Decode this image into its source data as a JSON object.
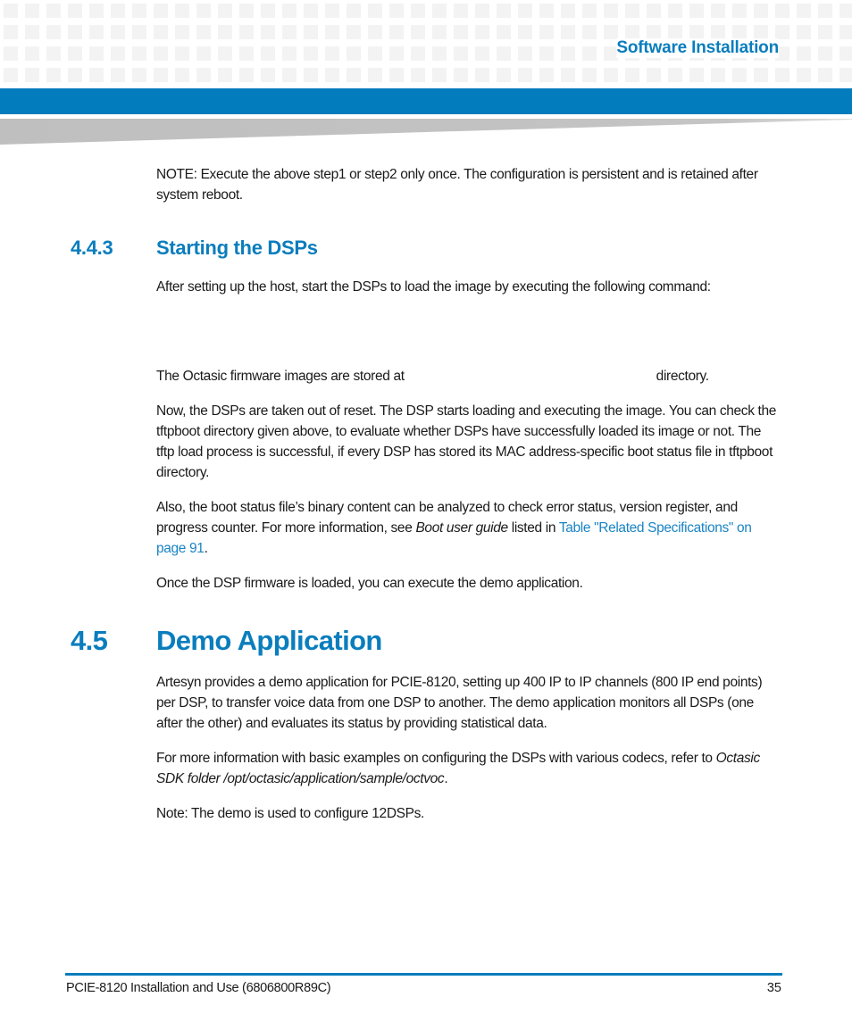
{
  "header": {
    "section_title": "Software Installation",
    "colors": {
      "accent": "#027cbd",
      "heading": "#0a7dbd",
      "link": "#1a84c4",
      "wedge": "#c0c0c0",
      "grid": "#f3f3f3"
    }
  },
  "content": {
    "note_para": "NOTE: Execute the above step1 or step2 only once. The configuration is persistent and is retained after system reboot.",
    "section_443": {
      "number": "4.4.3",
      "title": "Starting the DSPs",
      "para1": "After setting up the host, start the DSPs to load the image by executing the following command:",
      "para2_before": "The Octasic firmware images are stored at",
      "para2_after": "directory.",
      "para3": "Now, the DSPs are taken out of reset. The DSP starts loading and executing the image. You can check the tftpboot directory given above, to evaluate whether DSPs have successfully loaded its image or not. The tftp load process is successful, if every DSP has stored its MAC address-specific boot status file in tftpboot directory.",
      "para4_before": "Also, the boot status file’s binary content can be analyzed to check error status, version register, and progress counter. For more information, see ",
      "para4_italic": "Boot user guide",
      "para4_mid": " listed in ",
      "para4_link": "Table \"Related Specifications\" on page 91",
      "para4_after": ".",
      "para5": "Once the DSP firmware is loaded, you can execute the demo application."
    },
    "section_45": {
      "number": "4.5",
      "title": "Demo Application",
      "para1": "Artesyn provides a demo application for PCIE-8120, setting up 400 IP to IP channels (800 IP end points) per DSP, to transfer voice data from one DSP to another. The demo application monitors all DSPs (one after the other) and evaluates its status by providing statistical data.",
      "para2_before": "For more information with basic examples on configuring the DSPs with various codecs, refer to ",
      "para2_italic": "Octasic SDK folder /opt/octasic/application/sample/octvoc",
      "para2_after": ".",
      "para3": "Note: The demo is used to configure 12DSPs."
    }
  },
  "footer": {
    "doc_title": "PCIE-8120 Installation and Use (6806800R89C)",
    "page_number": "35"
  }
}
